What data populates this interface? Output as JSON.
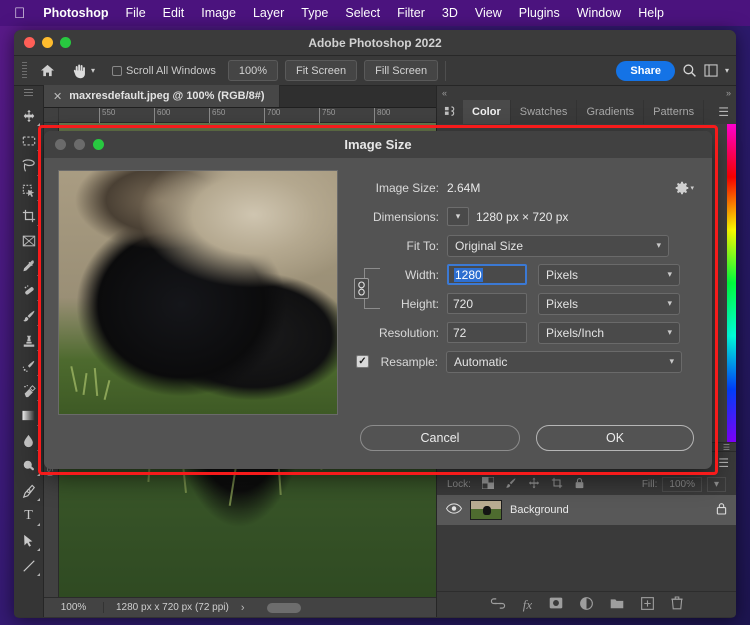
{
  "menubar": {
    "apple_icon": "apple-icon",
    "items": [
      {
        "label": "Photoshop",
        "bold": true
      },
      {
        "label": "File",
        "bold": false
      },
      {
        "label": "Edit",
        "bold": false
      },
      {
        "label": "Image",
        "bold": false
      },
      {
        "label": "Layer",
        "bold": false
      },
      {
        "label": "Type",
        "bold": false
      },
      {
        "label": "Select",
        "bold": false
      },
      {
        "label": "Filter",
        "bold": false
      },
      {
        "label": "3D",
        "bold": false
      },
      {
        "label": "View",
        "bold": false
      },
      {
        "label": "Plugins",
        "bold": false
      },
      {
        "label": "Window",
        "bold": false
      },
      {
        "label": "Help",
        "bold": false
      }
    ]
  },
  "window": {
    "title": "Adobe Photoshop 2022"
  },
  "options_bar": {
    "home_icon": "home-icon",
    "hand_icon": "hand-tool-icon",
    "scroll_all_label": "Scroll All Windows",
    "zoom_label": "100%",
    "fit_screen_label": "Fit Screen",
    "fill_screen_label": "Fill Screen",
    "share_label": "Share",
    "search_icon": "search-icon",
    "workspace_icon": "workspace-icon"
  },
  "document": {
    "tab_label": "maxresdefault.jpeg @ 100% (RGB/8#)",
    "close_icon": "close-icon",
    "ruler_ticks": [
      "550",
      "600",
      "650",
      "700",
      "750",
      "800"
    ]
  },
  "status_bar": {
    "zoom": "100%",
    "doc_size": "1280 px x 720 px (72 ppi)",
    "arrow_icon": "chevron-right-icon"
  },
  "toolbar": {
    "tools": [
      {
        "name": "move-tool",
        "glyph": "✣"
      },
      {
        "name": "marquee-tool",
        "glyph": "⬚"
      },
      {
        "name": "lasso-tool",
        "glyph": "⦸"
      },
      {
        "name": "quick-selection-tool",
        "glyph": "◱"
      },
      {
        "name": "crop-tool",
        "glyph": "⌑"
      },
      {
        "name": "frame-tool",
        "glyph": "⌧"
      },
      {
        "name": "eyedropper-tool",
        "glyph": "✒"
      },
      {
        "name": "healing-brush-tool",
        "glyph": "✎"
      },
      {
        "name": "brush-tool",
        "glyph": "✐"
      },
      {
        "name": "clone-stamp-tool",
        "glyph": "⚑"
      },
      {
        "name": "history-brush-tool",
        "glyph": "❀"
      },
      {
        "name": "eraser-tool",
        "glyph": "❖"
      },
      {
        "name": "gradient-tool",
        "glyph": "■"
      },
      {
        "name": "blur-tool",
        "glyph": "●"
      },
      {
        "name": "dodge-tool",
        "glyph": "◔"
      },
      {
        "name": "pen-tool",
        "glyph": "✑"
      },
      {
        "name": "type-tool",
        "glyph": "T"
      },
      {
        "name": "path-selection-tool",
        "glyph": "➤"
      },
      {
        "name": "line-tool",
        "glyph": "╱"
      }
    ]
  },
  "right_panels": {
    "color_group": {
      "tabs": [
        {
          "label": "Color",
          "active": true
        },
        {
          "label": "Swatches",
          "active": false
        },
        {
          "label": "Gradients",
          "active": false
        },
        {
          "label": "Patterns",
          "active": false
        }
      ],
      "menu_icon": "panel-menu-icon"
    },
    "layers": {
      "lock_label": "Lock:",
      "lock_icons": [
        "transparency-lock-icon",
        "brush-lock-icon",
        "position-lock-icon",
        "artboard-lock-icon",
        "lock-all-icon"
      ],
      "fill_label": "Fill:",
      "fill_value": "100%",
      "rows": [
        {
          "name": "Background",
          "visible": true,
          "locked": true
        }
      ],
      "footer_icons": [
        "link-layers-icon",
        "layer-styles-fx-icon",
        "layer-mask-icon",
        "adjustment-layer-icon",
        "new-group-icon",
        "new-layer-icon",
        "delete-layer-icon"
      ]
    }
  },
  "dialog": {
    "title": "Image Size",
    "traffic_lights": [
      "close-disabled",
      "minimize-disabled",
      "zoom-enabled"
    ],
    "gear_icon": "gear-icon",
    "image_size_label": "Image Size:",
    "image_size_value": "2.64M",
    "dimensions_label": "Dimensions:",
    "dimensions_value": "1280 px  ×  720 px",
    "dimensions_caret_icon": "chevron-down-icon",
    "fit_to_label": "Fit To:",
    "fit_to_value": "Original Size",
    "constrain_icon": "chain-link-icon",
    "width_label": "Width:",
    "width_value": "1280",
    "width_unit": "Pixels",
    "height_label": "Height:",
    "height_value": "720",
    "height_unit": "Pixels",
    "resolution_label": "Resolution:",
    "resolution_value": "72",
    "resolution_unit": "Pixels/Inch",
    "resample_label": "Resample:",
    "resample_value": "Automatic",
    "resample_checked": true,
    "cancel_label": "Cancel",
    "ok_label": "OK"
  },
  "highlight": {
    "color": "#f61b1b"
  }
}
